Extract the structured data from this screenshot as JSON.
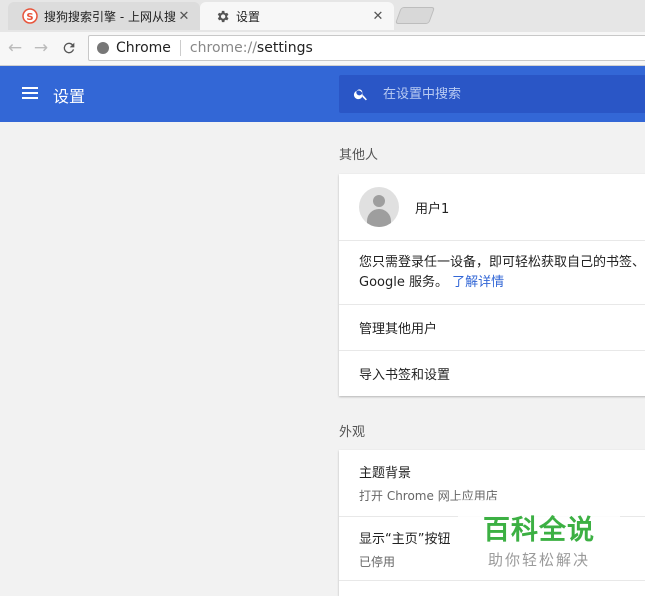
{
  "tabs": [
    {
      "title": "搜狗搜索引擎 - 上网从搜狗开始",
      "favicon": "sogou-icon",
      "active": false
    },
    {
      "title": "设置",
      "favicon": "gear-icon",
      "active": true
    }
  ],
  "omnibox": {
    "chip": "Chrome",
    "url_scheme": "chrome://",
    "url_path": "settings"
  },
  "header": {
    "title": "设置",
    "search_placeholder": "在设置中搜索"
  },
  "people": {
    "section_title": "其他人",
    "user_name": "用户1",
    "signin_text": "您只需登录任一设备，即可轻松获取自己的书签、",
    "signin_text_2": "Google 服务。",
    "learn_more": "了解详情",
    "manage_users": "管理其他用户",
    "import": "导入书签和设置"
  },
  "appearance": {
    "section_title": "外观",
    "theme_label": "主题背景",
    "theme_sub": "打开 Chrome 网上应用店",
    "home_label": "显示“主页”按钮",
    "home_sub": "已停用"
  },
  "watermark": {
    "title": "百科全说",
    "subtitle": "助你轻松解决"
  },
  "colors": {
    "header": "#3367d6",
    "link": "#3367d6",
    "watermark_green": "#3cb043"
  }
}
